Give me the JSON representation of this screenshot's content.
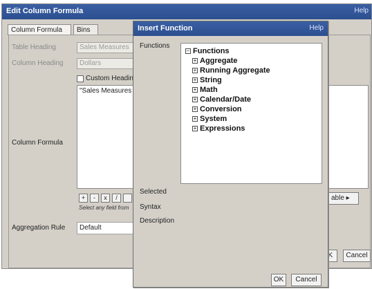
{
  "back_dialog": {
    "title": "Edit Column Formula",
    "help": "Help",
    "tabs": [
      {
        "label": "Column Formula"
      },
      {
        "label": "Bins"
      }
    ],
    "fields": {
      "table_heading_label": "Table Heading",
      "table_heading_value": "Sales Measures",
      "column_heading_label": "Column Heading",
      "column_heading_value": "Dollars",
      "custom_heading_label": "Custom Headin",
      "formula_text": "\"Sales Measures",
      "column_formula_label": "Column Formula",
      "operators": [
        "+",
        "-",
        "x",
        "/"
      ],
      "operators_hint": "Select any field from",
      "variable_button": "able ▸",
      "aggregation_label": "Aggregation Rule",
      "aggregation_value": "Default"
    },
    "buttons": {
      "ok": "OK",
      "cancel": "Cancel"
    }
  },
  "insert_function": {
    "title": "Insert Function",
    "help": "Help",
    "functions_label": "Functions",
    "tree": {
      "root": {
        "label": "Functions",
        "expander": "−"
      },
      "children": [
        {
          "label": "Aggregate",
          "expander": "+"
        },
        {
          "label": "Running Aggregate",
          "expander": "+"
        },
        {
          "label": "String",
          "expander": "+"
        },
        {
          "label": "Math",
          "expander": "+"
        },
        {
          "label": "Calendar/Date",
          "expander": "+"
        },
        {
          "label": "Conversion",
          "expander": "+"
        },
        {
          "label": "System",
          "expander": "+"
        },
        {
          "label": "Expressions",
          "expander": "+"
        }
      ]
    },
    "selected_label": "Selected",
    "syntax_label": "Syntax",
    "description_label": "Description",
    "ok_label": "OK",
    "cancel_label": "Cancel"
  }
}
